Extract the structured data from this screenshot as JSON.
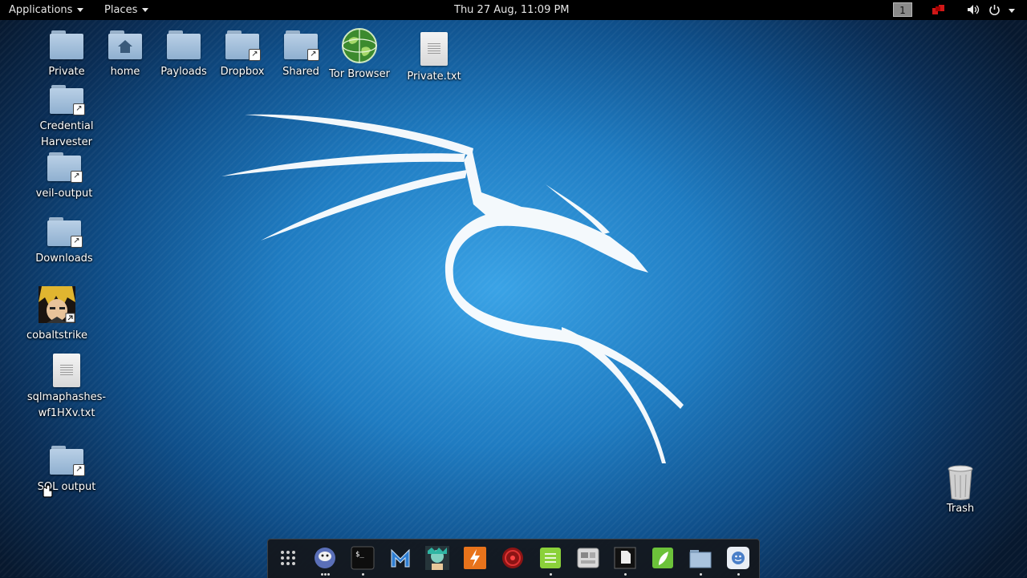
{
  "topbar": {
    "applications_label": "Applications",
    "places_label": "Places",
    "clock": "Thu 27 Aug, 11:09 PM",
    "workspace_number": "1"
  },
  "desktop_icons": {
    "private": "Private",
    "home": "home",
    "payloads": "Payloads",
    "dropbox": "Dropbox",
    "shared": "Shared",
    "tor_browser": "Tor Browser",
    "private_txt": "Private.txt",
    "credential_harvester": "Credential Harvester",
    "veil_output": "veil-output",
    "downloads": "Downloads",
    "cobaltstrike": "cobaltstrike",
    "sqlmaphashes_line1": "sqlmaphashes-",
    "sqlmaphashes_line2": "wf1HXv.txt",
    "sql_output": "SQL output",
    "trash": "Trash"
  },
  "dock_apps": [
    {
      "icon": "show-apps-grid-icon"
    },
    {
      "icon": "iceweasel-icon"
    },
    {
      "icon": "terminal-icon"
    },
    {
      "icon": "metasploit-icon"
    },
    {
      "icon": "armitage-icon"
    },
    {
      "icon": "burpsuite-icon"
    },
    {
      "icon": "faraday-icon"
    },
    {
      "icon": "text-editor-icon"
    },
    {
      "icon": "screenshot-icon"
    },
    {
      "icon": "notes-icon"
    },
    {
      "icon": "leafpad-icon"
    },
    {
      "icon": "files-icon"
    },
    {
      "icon": "chat-icon"
    }
  ],
  "colors": {
    "topbar_bg": "#000000",
    "desktop_center": "#3aa3e6",
    "desktop_edge": "#07182e"
  }
}
